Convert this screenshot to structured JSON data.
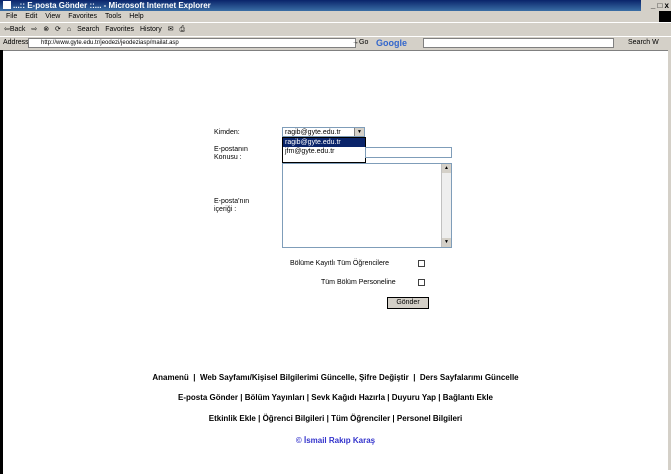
{
  "window": {
    "title": "...:: E-posta Gönder ::... - Microsoft Internet Explorer",
    "controls": "_ □ x"
  },
  "menu": [
    "File",
    "Edit",
    "View",
    "Favorites",
    "Tools",
    "Help"
  ],
  "toolbar": {
    "back": "⇦Back",
    "forward": "⇨",
    "search": "Search",
    "favorites": "Favorites",
    "history": "History"
  },
  "address": {
    "label": "Address",
    "url": "http://www.gyte.edu.tr/jeodezi/jeodeziasp/mailat.asp",
    "go": "Go",
    "google": "Google",
    "search_web": "Search W"
  },
  "form": {
    "from_label": "Kimden:",
    "from_value": "ragib@gyte.edu.tr",
    "from_options": [
      "ragib@gyte.edu.tr",
      "jfm@gyte.edu.tr"
    ],
    "subject_label_1": "E-postanın",
    "subject_label_2": "Konusu :",
    "body_label_1": "E-posta'nın",
    "body_label_2": "içeriği :",
    "opt_students": "Bölüme Kayıtlı Tüm Öğrencilere",
    "opt_staff": "Tüm Bölüm Personeline",
    "send_label": "Gönder"
  },
  "footer": {
    "line1": [
      "Anamenü",
      "Web Sayfamı/Kişisel Bilgilerimi Güncelle, Şifre Değiştir",
      "Ders Sayfalarımı Güncelle"
    ],
    "line2": [
      "E-posta Gönder",
      "Bölüm Yayınları",
      "Sevk Kağıdı Hazırla",
      "Duyuru Yap",
      "Bağlantı Ekle"
    ],
    "line3": [
      "Etkinlik Ekle",
      "Öğrenci Bilgileri",
      "Tüm Öğrenciler",
      "Personel Bilgileri"
    ],
    "credit": "© İsmail Rakıp Karaş"
  }
}
